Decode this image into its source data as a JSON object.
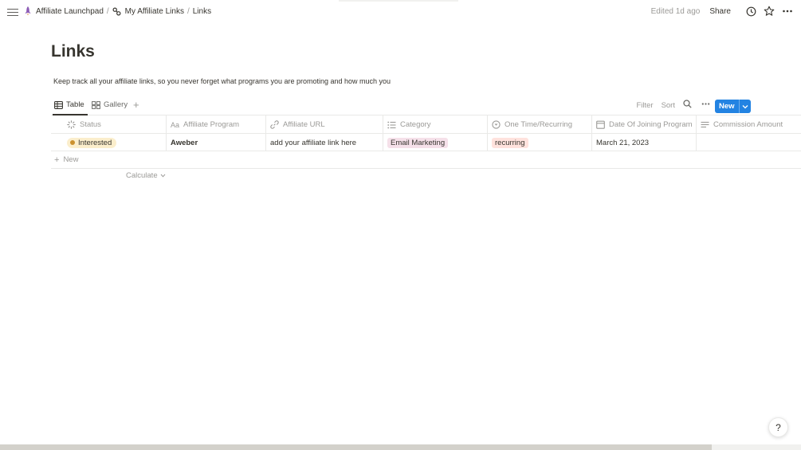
{
  "breadcrumb": {
    "items": [
      {
        "label": "Affiliate Launchpad",
        "icon": "rocket-icon"
      },
      {
        "label": "My Affiliate Links",
        "icon": "link-icon"
      },
      {
        "label": "Links"
      }
    ],
    "separator": "/"
  },
  "topbar": {
    "edited": "Edited 1d ago",
    "share": "Share"
  },
  "page": {
    "title": "Links",
    "description": "Keep track all your affiliate links, so you never forget what programs you are promoting and how much you"
  },
  "views": {
    "tabs": [
      {
        "label": "Table",
        "active": true
      },
      {
        "label": "Gallery",
        "active": false
      }
    ],
    "add": "+",
    "filter": "Filter",
    "sort": "Sort",
    "new": "New"
  },
  "table": {
    "columns": [
      {
        "label": "Status",
        "icon": "status-icon"
      },
      {
        "label": "Affiliate Program",
        "icon": "text-icon"
      },
      {
        "label": "Affiliate URL",
        "icon": "url-icon"
      },
      {
        "label": "Category",
        "icon": "list-icon"
      },
      {
        "label": "One Time/Recurring",
        "icon": "select-icon"
      },
      {
        "label": "Date Of Joining Program",
        "icon": "calendar-icon"
      },
      {
        "label": "Commission Amount",
        "icon": "lines-icon"
      }
    ],
    "rows": [
      {
        "status": "Interested",
        "program": "Aweber",
        "url": "add your affiliate link here",
        "category": "Email Marketing",
        "recurring": "recurring",
        "date": "March 21, 2023",
        "commission": ""
      }
    ],
    "new_row": "New",
    "calculate": "Calculate"
  },
  "help": "?",
  "colors": {
    "accent": "#2383e2",
    "status_bg": "#fbeecc",
    "status_dot": "#cb912f",
    "category_bg": "#f5e0e9",
    "recurring_bg": "#ffe2dd"
  }
}
